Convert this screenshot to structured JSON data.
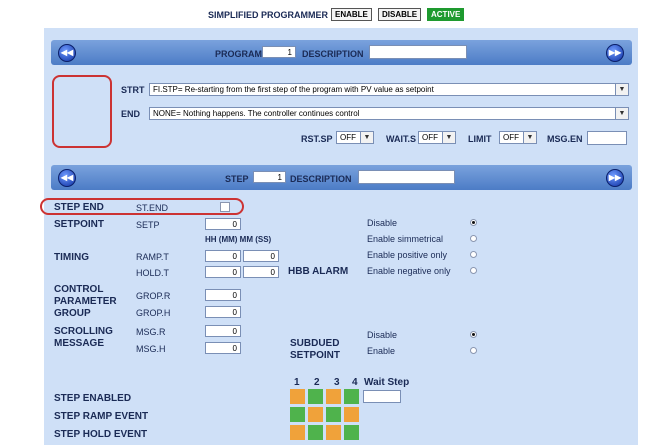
{
  "top": {
    "title": "SIMPLIFIED PROGRAMMER",
    "enable_label": "ENABLE",
    "disable_label": "DISABLE",
    "active_label": "ACTIVE"
  },
  "program": {
    "label": "PROGRAM",
    "number": "1",
    "description_label": "DESCRIPTION",
    "description_value": ""
  },
  "strt": {
    "label": "STRT",
    "value": "FI.STP= Re-starting from the first step of the program with PV value as setpoint"
  },
  "end": {
    "label": "END",
    "value": "NONE= Nothing happens. The controller continues control"
  },
  "rst": {
    "label": "RST.SP",
    "value": "OFF"
  },
  "wait": {
    "label": "WAIT.S",
    "value": "OFF"
  },
  "limit": {
    "label": "LIMIT",
    "value": "OFF"
  },
  "msgen": {
    "label": "MSG.EN",
    "value": ""
  },
  "step": {
    "label": "STEP",
    "number": "1",
    "description_label": "DESCRIPTION",
    "description_value": ""
  },
  "step_end": {
    "label": "STEP END",
    "code": "ST.END"
  },
  "setpoint": {
    "label": "SETPOINT",
    "code": "SETP",
    "value": "0"
  },
  "timing": {
    "label": "TIMING",
    "header": "HH (MM) MM (SS)",
    "ramp_code": "RAMP.T",
    "ramp_a": "0",
    "ramp_b": "0",
    "hold_code": "HOLD.T",
    "hold_a": "0",
    "hold_b": "0"
  },
  "control": {
    "label_l1": "CONTROL",
    "label_l2": "PARAMETER",
    "label_l3": "GROUP",
    "r_code": "GROP.R",
    "r_value": "0",
    "h_code": "GROP.H",
    "h_value": "0"
  },
  "scroll": {
    "label_l1": "SCROLLING",
    "label_l2": "MESSAGE",
    "r_code": "MSG.R",
    "r_value": "0",
    "h_code": "MSG.H",
    "h_value": "0"
  },
  "hbb": {
    "label": "HBB ALARM",
    "options": [
      "Disable",
      "Enable simmetrical",
      "Enable positive only",
      "Enable negative only"
    ],
    "selected_index": 0
  },
  "subdued": {
    "label_l1": "SUBDUED",
    "label_l2": "SETPOINT",
    "options": [
      "Disable",
      "Enable"
    ],
    "selected_index": 0
  },
  "grid": {
    "col_labels": [
      "1",
      "2",
      "3",
      "4"
    ],
    "wait_label": "Wait Step",
    "rows": [
      "STEP ENABLED",
      "STEP RAMP EVENT",
      "STEP HOLD EVENT"
    ],
    "colors": {
      "on": "#4fb34c",
      "off": "#f0a23a"
    },
    "states": [
      [
        0,
        1,
        0,
        1
      ],
      [
        1,
        0,
        1,
        0
      ],
      [
        0,
        1,
        0,
        1
      ]
    ]
  },
  "colors": {
    "panel": "#cfe0f7",
    "band": "#5f8ed3",
    "accent_green": "#1e9a2f",
    "annotation": "#cc3333"
  }
}
